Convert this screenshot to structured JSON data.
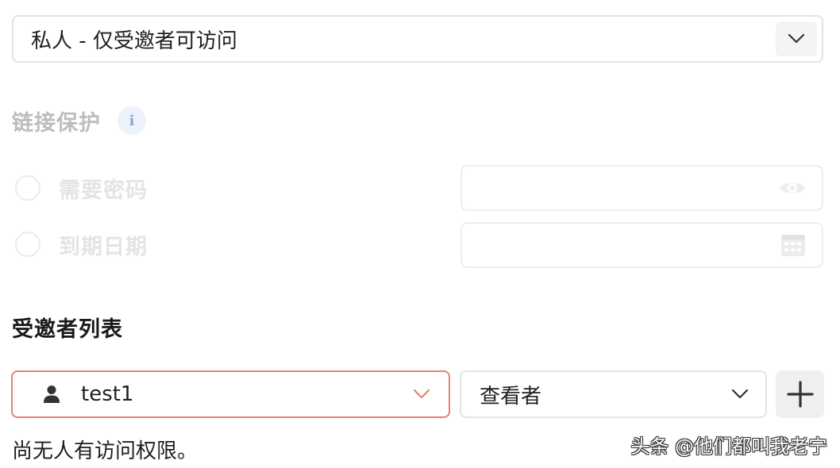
{
  "access": {
    "selected": "私人 - 仅受邀者可访问",
    "icon": "chevron-down-icon"
  },
  "link_protection": {
    "title": "链接保护",
    "info_icon_label": "i",
    "options": [
      {
        "label": "需要密码",
        "selected": false,
        "field_value": "",
        "field_icon": "eye-icon"
      },
      {
        "label": "到期日期",
        "selected": false,
        "field_value": "",
        "field_icon": "calendar-icon"
      }
    ]
  },
  "invitees": {
    "title": "受邀者列表",
    "user_select": {
      "value": "test1",
      "icon": "user-icon"
    },
    "role_select": {
      "value": "查看者"
    },
    "add_icon": "plus-icon",
    "empty_text": "尚无人有访问权限。"
  },
  "watermark": "头条 @他们都叫我老宁",
  "colors": {
    "accent_border": "#e5826f",
    "disabled_text": "#e4e4e4",
    "info_badge": "#eef3fb"
  }
}
